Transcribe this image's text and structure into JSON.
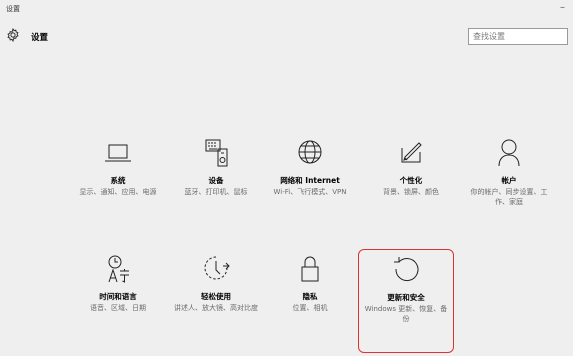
{
  "window": {
    "title": "设置",
    "minimize_glyph": "–"
  },
  "header": {
    "title": "设置",
    "icon": "gear-icon"
  },
  "search": {
    "placeholder": "查找设置",
    "value": ""
  },
  "tiles": [
    {
      "icon": "laptop-icon",
      "label": "系统",
      "desc": "显示、通知、应用、电源"
    },
    {
      "icon": "keyboard-icon",
      "label": "设备",
      "desc": "蓝牙、打印机、鼠标"
    },
    {
      "icon": "globe-icon",
      "label": "网络和 Internet",
      "desc": "Wi-Fi、飞行模式、VPN"
    },
    {
      "icon": "personalization-icon",
      "label": "个性化",
      "desc": "背景、锁屏、颜色"
    },
    {
      "icon": "person-icon",
      "label": "帐户",
      "desc": "你的帐户、同步设置、工作、家庭"
    },
    {
      "icon": "time-language-icon",
      "label": "时间和语言",
      "desc": "语音、区域、日期"
    },
    {
      "icon": "ease-of-access-icon",
      "label": "轻松使用",
      "desc": "讲述人、放大镜、高对比度"
    },
    {
      "icon": "lock-icon",
      "label": "隐私",
      "desc": "位置、相机"
    },
    {
      "icon": "update-icon",
      "label": "更新和安全",
      "desc": "Windows 更新、恢复、备份"
    }
  ],
  "colors": {
    "background": "#efefef",
    "highlight_border": "#d33333",
    "description_text": "#6b6b6b"
  }
}
